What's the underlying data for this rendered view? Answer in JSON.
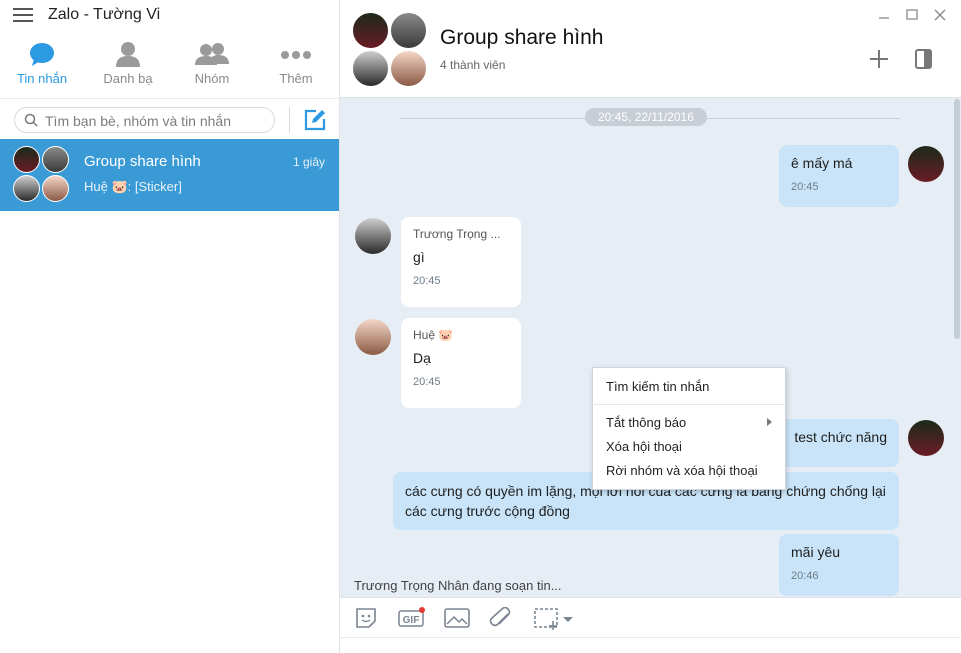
{
  "sidebar": {
    "app_title": "Zalo - Tường Vi",
    "tabs": [
      {
        "label": "Tin nhắn",
        "icon": "chat-bubble-icon",
        "active": true
      },
      {
        "label": "Danh bạ",
        "icon": "person-icon"
      },
      {
        "label": "Nhóm",
        "icon": "group-icon"
      },
      {
        "label": "Thêm",
        "icon": "more-dots-icon"
      }
    ],
    "search": {
      "placeholder": "Tìm bạn bè, nhóm và tin nhắn",
      "value": ""
    },
    "conversations": [
      {
        "name": "Group share hình",
        "time": "1 giây",
        "preview": "Huệ 🐷: [Sticker]"
      }
    ]
  },
  "chat": {
    "title": "Group share hình",
    "members": "4 thành viên",
    "date_separator": "20:45, 22/11/2016",
    "messages": [
      {
        "direction": "out",
        "text": "ê mấy má",
        "time": "20:45"
      },
      {
        "direction": "in",
        "sender": "Trương Trọng ...",
        "text": "gì",
        "time": "20:45"
      },
      {
        "direction": "in",
        "sender": "Huệ 🐷",
        "text": "Dạ",
        "time": "20:45"
      },
      {
        "direction": "out",
        "text": "test chức năng"
      },
      {
        "direction": "out",
        "text": "các cưng có quyền im lặng, mọi lời nói của các cưng là bằng chứng chống lại các cưng trước cộng đồng"
      },
      {
        "direction": "out",
        "text": "mãi yêu",
        "time": "20:46"
      }
    ],
    "typing_indicator": "Trương Trọng Nhân đang soạn tin...",
    "toolbar": [
      "emoji-icon",
      "gif-icon",
      "image-icon",
      "attach-icon",
      "screenshot-icon"
    ]
  },
  "context_menu": {
    "items": [
      "Tìm kiếm tin nhắn",
      "Tắt thông báo",
      "Xóa hội thoại",
      "Rời nhóm và xóa hội thoại"
    ]
  },
  "colors": {
    "accent": "#2b9ae3",
    "selected_row": "#3a9ad6",
    "out_bubble": "#c9e4f8",
    "chat_bg": "#e6edf4"
  }
}
